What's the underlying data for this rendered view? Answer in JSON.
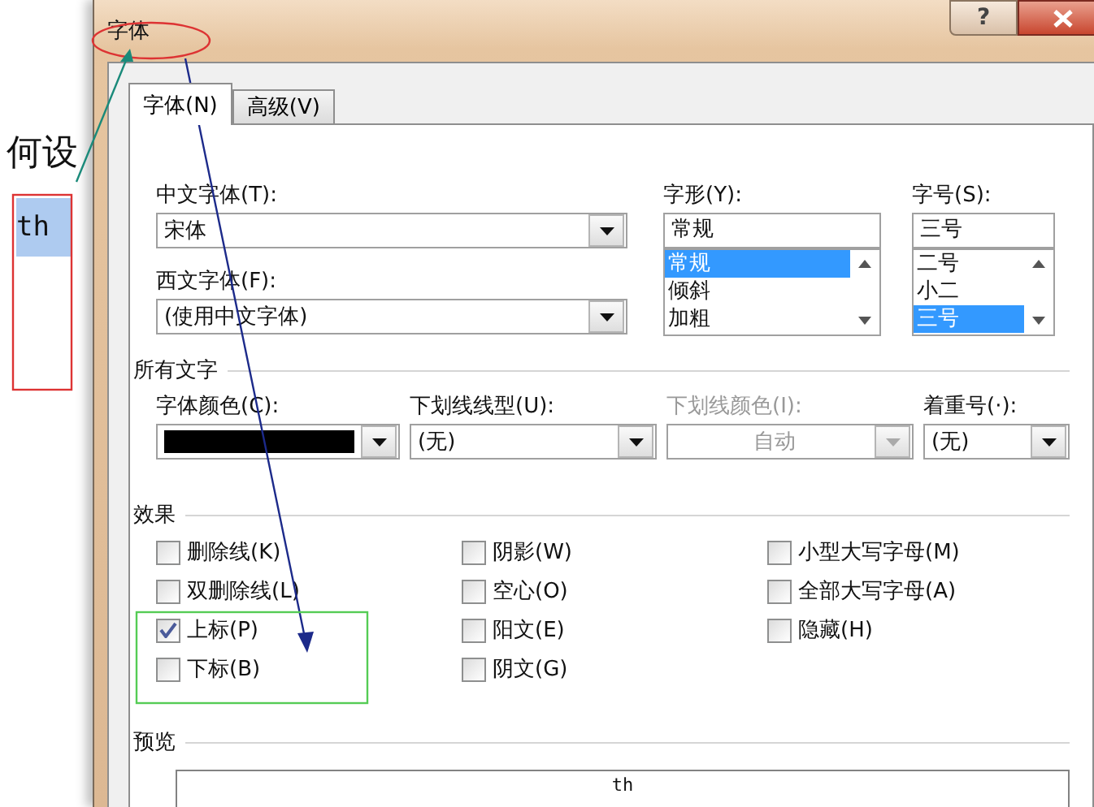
{
  "document": {
    "heading": "何设",
    "selected_text": "th"
  },
  "window": {
    "title": "字体",
    "help": "?"
  },
  "tabs": [
    {
      "label": "字体(N)",
      "selected": true
    },
    {
      "label": "高级(V)",
      "selected": false
    }
  ],
  "chinese_font": {
    "label": "中文字体(T):",
    "value": "宋体"
  },
  "western_font": {
    "label": "西文字体(F):",
    "value": "(使用中文字体)"
  },
  "font_style": {
    "label": "字形(Y):",
    "value": "常规",
    "options": [
      {
        "label": "常规",
        "selected": true
      },
      {
        "label": "倾斜",
        "selected": false
      },
      {
        "label": "加粗",
        "selected": false
      }
    ]
  },
  "font_size": {
    "label": "字号(S):",
    "value": "三号",
    "options": [
      {
        "label": "二号",
        "selected": false
      },
      {
        "label": "小二",
        "selected": false
      },
      {
        "label": "三号",
        "selected": true
      }
    ]
  },
  "all_text": {
    "title": "所有文字",
    "fields": [
      {
        "kind": "color",
        "label": "字体颜色(C):",
        "color": "#000000",
        "disabled": false
      },
      {
        "kind": "select",
        "label": "下划线线型(U):",
        "value": "(无)",
        "disabled": false
      },
      {
        "kind": "select",
        "label": "下划线颜色(I):",
        "value": "自动",
        "disabled": true
      },
      {
        "kind": "select",
        "label": "着重号(·):",
        "value": "(无)",
        "disabled": false
      }
    ]
  },
  "effects": {
    "title": "效果",
    "columns": [
      [
        {
          "label": "删除线(K)",
          "checked": false
        },
        {
          "label": "双删除线(L)",
          "checked": false
        },
        {
          "label": "上标(P)",
          "checked": true
        },
        {
          "label": "下标(B)",
          "checked": false
        }
      ],
      [
        {
          "label": "阴影(W)",
          "checked": false
        },
        {
          "label": "空心(O)",
          "checked": false
        },
        {
          "label": "阳文(E)",
          "checked": false
        },
        {
          "label": "阴文(G)",
          "checked": false
        }
      ],
      [
        {
          "label": "小型大写字母(M)",
          "checked": false
        },
        {
          "label": "全部大写字母(A)",
          "checked": false
        },
        {
          "label": "隐藏(H)",
          "checked": false
        }
      ]
    ]
  },
  "preview": {
    "title": "预览",
    "sample": "th"
  }
}
